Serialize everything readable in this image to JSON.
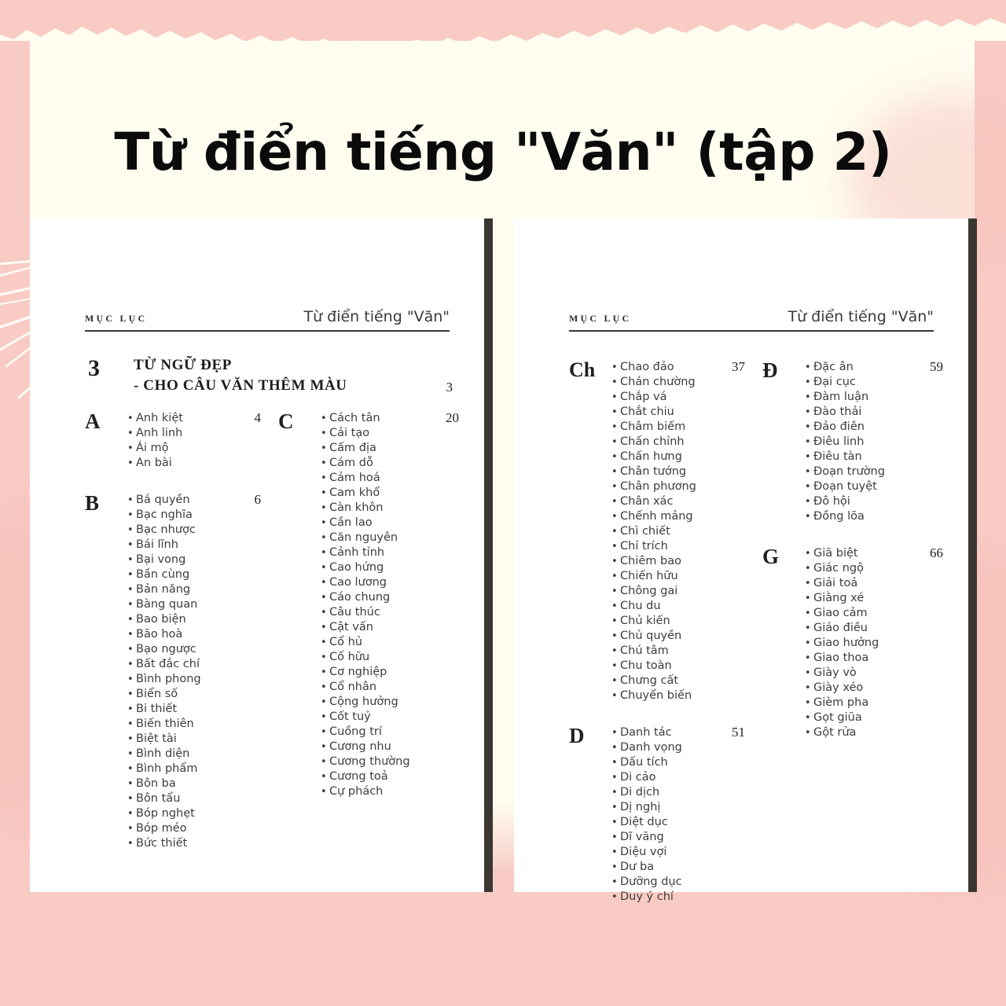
{
  "poster": {
    "title": "Từ điển tiếng \"Văn\" (tập 2)",
    "colors": {
      "pink": "#f8cbc4",
      "cream": "#fffdf0",
      "page": "#ffffff",
      "page_edge": "#3b3630",
      "ink": "#3d3d3d",
      "heading_ink": "#1c1c1c"
    }
  },
  "pages": [
    {
      "id": "page-left",
      "runhead": {
        "left": "MỤC LỤC",
        "right": "Từ điển tiếng \"Văn\""
      },
      "chapter": {
        "number": "3",
        "title_line1": "TỪ NGỮ ĐẸP",
        "title_line2": "- CHO CÂU VĂN THÊM MÀU",
        "page": "3"
      },
      "columns": [
        {
          "id": "col-1",
          "groups": [
            {
              "letter": "A",
              "page": "4",
              "entries": [
                "Anh kiệt",
                "Anh linh",
                "Ái mộ",
                "An bài"
              ]
            },
            {
              "letter": "B",
              "page": "6",
              "entries": [
                "Bá quyền",
                "Bạc nghĩa",
                "Bạc nhược",
                "Bái lĩnh",
                "Bại vong",
                "Bần cùng",
                "Bản năng",
                "Bàng quan",
                "Bao biện",
                "Bão hoà",
                "Bạo ngược",
                "Bất đắc chí",
                "Bình phong",
                "Biển số",
                "Bi thiết",
                "Biến thiên",
                "Biệt tài",
                "Bình diện",
                "Bình phẩm",
                "Bôn ba",
                "Bôn tẩu",
                "Bóp nghẹt",
                "Bóp méo",
                "Bức thiết"
              ]
            }
          ]
        },
        {
          "id": "col-2",
          "groups": [
            {
              "letter": "C",
              "page": "20",
              "entries": [
                "Cách tân",
                "Cải tạo",
                "Cấm địa",
                "Cám dỗ",
                "Cảm hoá",
                "Cam khổ",
                "Càn khôn",
                "Cần lao",
                "Căn nguyên",
                "Cảnh tỉnh",
                "Cao hứng",
                "Cao lương",
                "Cáo chung",
                "Câu thúc",
                "Cật vấn",
                "Cổ hủ",
                "Cố hữu",
                "Cơ nghiệp",
                "Cổ nhân",
                "Cộng hưởng",
                "Cốt tuỷ",
                "Cuồng trí",
                "Cương nhu",
                "Cương thường",
                "Cương toả",
                "Cự phách"
              ]
            }
          ]
        }
      ]
    },
    {
      "id": "page-right",
      "runhead": {
        "left": "MỤC LỤC",
        "right": "Từ điển tiếng \"Văn\""
      },
      "chapter": null,
      "columns": [
        {
          "id": "col-1",
          "groups": [
            {
              "letter": "Ch",
              "page": "37",
              "entries": [
                "Chao đảo",
                "Chán chường",
                "Chắp vá",
                "Chắt chiu",
                "Châm biếm",
                "Chấn chỉnh",
                "Chấn hưng",
                "Chân tướng",
                "Chân phương",
                "Chân xác",
                "Chếnh mảng",
                "Chì chiết",
                "Chỉ trích",
                "Chiêm bao",
                "Chiến hữu",
                "Chông gai",
                "Chu du",
                "Chủ kiến",
                "Chủ quyền",
                "Chú tâm",
                "Chu toàn",
                "Chưng cất",
                "Chuyển biến"
              ]
            },
            {
              "letter": "D",
              "page": "51",
              "entries": [
                "Danh tác",
                "Danh vọng",
                "Dấu tích",
                "Di cảo",
                "Di dịch",
                "Dị nghị",
                "Diệt dục",
                "Dĩ vãng",
                "Diệu vợi",
                "Dư ba",
                "Dưỡng dục",
                "Duy ý chí"
              ]
            }
          ]
        },
        {
          "id": "col-2",
          "groups": [
            {
              "letter": "Đ",
              "page": "59",
              "entries": [
                "Đặc ân",
                "Đại cục",
                "Đàm luận",
                "Đào thải",
                "Đảo điên",
                "Điêu linh",
                "Điêu tàn",
                "Đoạn trường",
                "Đoạn tuyệt",
                "Đô hội",
                "Đồng lõa"
              ]
            },
            {
              "letter": "G",
              "page": "66",
              "entries": [
                "Giã biệt",
                "Giác ngộ",
                "Giải toả",
                "Giằng xé",
                "Giao cảm",
                "Giáo điều",
                "Giao hưởng",
                "Giao thoa",
                "Giày vò",
                "Giày xéo",
                "Gièm pha",
                "Gọt giũa",
                "Gột rửa"
              ]
            }
          ]
        }
      ]
    }
  ]
}
